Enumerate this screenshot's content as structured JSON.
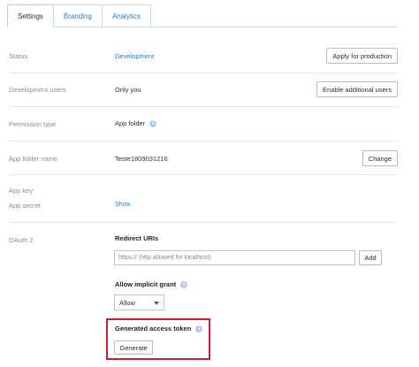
{
  "tabs": [
    {
      "label": "Settings"
    },
    {
      "label": "Branding"
    },
    {
      "label": "Analytics"
    }
  ],
  "status": {
    "label": "Status",
    "value": "Development",
    "button": "Apply for production"
  },
  "dev_users": {
    "label": "Development users",
    "value": "Only you",
    "button": "Enable additional users"
  },
  "permission": {
    "label": "Permission type",
    "value": "App folder"
  },
  "app_folder": {
    "label": "App folder name",
    "value": "Teste1809031216",
    "button": "Change"
  },
  "app_key": {
    "label": "App key"
  },
  "app_secret": {
    "label": "App secret",
    "value": "Show"
  },
  "oauth": {
    "label": "OAuth 2",
    "redirect_title": "Redirect URIs",
    "redirect_placeholder": "https:// (http allowed for localhost)",
    "add_button": "Add",
    "implicit_title": "Allow implicit grant",
    "implicit_value": "Allow",
    "token_title": "Generated access token",
    "generate_button": "Generate"
  },
  "colors": {
    "link": "#2a7ac2",
    "highlight": "#c8202a"
  }
}
